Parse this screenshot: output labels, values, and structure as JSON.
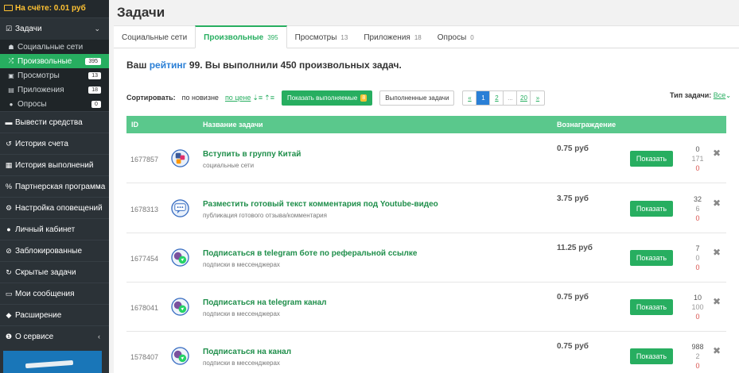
{
  "sidebar": {
    "balance": "На счёте: 0.01 руб",
    "tasks_section": "Задачи",
    "sub_items": [
      {
        "label": "Социальные сети",
        "icon": "users-icon",
        "count": ""
      },
      {
        "label": "Произвольные",
        "icon": "random-icon",
        "count": "395",
        "active": true
      },
      {
        "label": "Просмотры",
        "icon": "eye-icon",
        "count": "13"
      },
      {
        "label": "Приложения",
        "icon": "apps-icon",
        "count": "18"
      },
      {
        "label": "Опросы",
        "icon": "question-icon",
        "count": "0"
      }
    ],
    "items": [
      {
        "label": "Вывести средства",
        "icon": "withdraw-icon"
      },
      {
        "label": "История счета",
        "icon": "history-icon"
      },
      {
        "label": "История выполнений",
        "icon": "list-icon"
      },
      {
        "label": "Партнерская программа",
        "icon": "percent-icon"
      },
      {
        "label": "Настройка оповещений",
        "icon": "cogs-icon"
      },
      {
        "label": "Личный кабинет",
        "icon": "user-icon"
      },
      {
        "label": "Заблокированные",
        "icon": "block-icon"
      },
      {
        "label": "Скрытые задачи",
        "icon": "hidden-icon"
      },
      {
        "label": "Мои сообщения",
        "icon": "message-icon"
      },
      {
        "label": "Расширение",
        "icon": "puzzle-icon"
      },
      {
        "label": "О сервисе",
        "icon": "info-icon"
      }
    ]
  },
  "header": {
    "title": "Задачи"
  },
  "tabs": [
    {
      "label": "Социальные сети",
      "num": ""
    },
    {
      "label": "Произвольные",
      "num": "395"
    },
    {
      "label": "Просмотры",
      "num": "13"
    },
    {
      "label": "Приложения",
      "num": "18"
    },
    {
      "label": "Опросы",
      "num": "0"
    }
  ],
  "rating": {
    "pre": "Ваш ",
    "link": "рейтинг",
    "post": " 99. Вы выполнили 450 произвольных задач."
  },
  "sortbar": {
    "label": "Сортировать:",
    "by_new": "по новизне",
    "by_price": "по цене",
    "show_done": "Показать выполняемые",
    "show_done_count": "8",
    "completed": "Выполненные задачи",
    "pager": [
      "«",
      "1",
      "2",
      "...",
      "20",
      "»"
    ],
    "type_label": "Тип задачи:",
    "type_value": "Все"
  },
  "table": {
    "headers": {
      "id": "ID",
      "name": "Название задачи",
      "reward": "Вознаграждение"
    },
    "show_label": "Показать",
    "rows": [
      {
        "id": "1677857",
        "title": "Вступить в группу Китай",
        "cat": "социальные сети",
        "reward": "0.75 руб",
        "s1": "0",
        "s2": "171",
        "s3": "0",
        "icon": "social-icon"
      },
      {
        "id": "1678313",
        "title": "Разместить готовый текст комментария под Youtube-видео",
        "cat": "публикация готового отзыва/комментария",
        "reward": "3.75 руб",
        "s1": "32",
        "s2": "6",
        "s3": "0",
        "icon": "comment-icon"
      },
      {
        "id": "1677454",
        "title": "Подписаться в telegram боте по реферальной ссылке",
        "cat": "подписки в мессенджерах",
        "reward": "11.25 руб",
        "s1": "7",
        "s2": "0",
        "s3": "0",
        "icon": "messenger-icon"
      },
      {
        "id": "1678041",
        "title": "Подписаться на telegram канал",
        "cat": "подписки в мессенджерах",
        "reward": "0.75 руб",
        "s1": "10",
        "s2": "100",
        "s3": "0",
        "icon": "messenger-icon"
      },
      {
        "id": "1578407",
        "title": "Подписаться на канал",
        "cat": "подписки в мессенджерах",
        "reward": "0.75 руб",
        "s1": "988",
        "s2": "2",
        "s3": "0",
        "icon": "messenger-icon"
      }
    ]
  }
}
